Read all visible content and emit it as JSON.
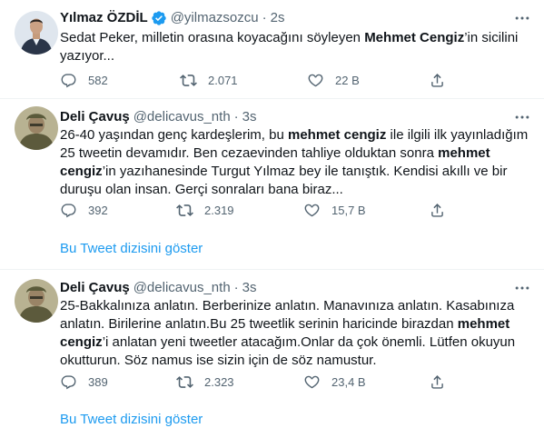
{
  "tweets": [
    {
      "name": "Yılmaz ÖZDİL",
      "handle": "@yilmazsozcu",
      "time": "2s",
      "text_parts": [
        "Sedat Peker, milletin orasına koyacağını söyleyen ",
        "Mehmet Cengiz",
        "’in sicilini yazıyor..."
      ],
      "reply_count": "582",
      "retweet_count": "2.071",
      "like_count": "22 B"
    },
    {
      "name": "Deli Çavuş",
      "handle": "@delicavus_nth",
      "time": "3s",
      "text_parts": [
        "26-40 yaşından genç kardeşlerim, bu ",
        "mehmet cengiz",
        " ile ilgili ilk yayınladığım 25 tweetin devamıdır. Ben cezaevinden tahliye olduktan sonra ",
        "mehmet cengiz",
        "’in yazıhanesinde Turgut Yılmaz bey ile tanıştık. Kendisi akıllı ve bir duruşu olan insan. Gerçi sonraları bana biraz..."
      ],
      "reply_count": "392",
      "retweet_count": "2.319",
      "like_count": "15,7 B",
      "show_thread": "Bu Tweet dizisini göster"
    },
    {
      "name": "Deli Çavuş",
      "handle": "@delicavus_nth",
      "time": "3s",
      "text_parts": [
        "25-Bakkalınıza anlatın. Berberinize anlatın. Manavınıza anlatın. Kasabınıza anlatın. Birilerine anlatın.Bu 25 tweetlik serinin haricinde birazdan ",
        "mehmet cengiz",
        "’i anlatan yeni tweetler atacağım.Onlar da çok önemli. Lütfen okuyun okutturun. Söz namus ise sizin için de söz namustur."
      ],
      "reply_count": "389",
      "retweet_count": "2.323",
      "like_count": "23,4 B",
      "show_thread": "Bu Tweet dizisini göster"
    }
  ],
  "colors": {
    "text": "#0f1419",
    "secondary": "#536471",
    "link": "#1d9bf0",
    "divider": "#eff3f4"
  },
  "icons": [
    "verified-badge-icon",
    "more-icon",
    "reply-icon",
    "retweet-icon",
    "like-icon",
    "share-icon"
  ]
}
